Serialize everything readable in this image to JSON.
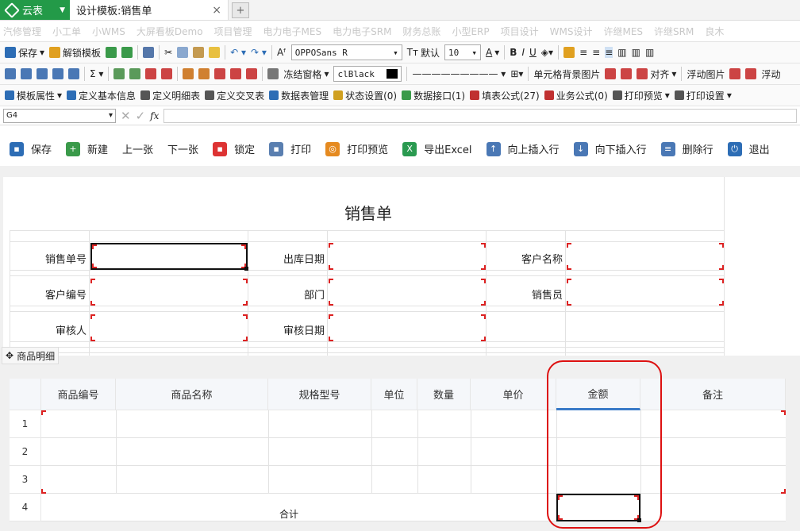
{
  "titlebar": {
    "app_name": "云表",
    "doc_tab": "设计模板:销售单",
    "close_symbol": "×",
    "newtab_symbol": "+"
  },
  "menubar": {
    "items": [
      "汽修管理",
      "小工单",
      "小WMS",
      "大屏看板Demo",
      "项目管理",
      "电力电子MES",
      "电力电子SRM",
      "财务总账",
      "小型ERP",
      "项目设计",
      "WMS设计",
      "许继MES",
      "许继SRM",
      "良木"
    ]
  },
  "toolbar1": {
    "save": "保存",
    "unlock": "解锁模板",
    "font": "OPPOSans R",
    "default_label": "默认",
    "size": "10"
  },
  "toolbar2": {
    "freeze": "冻结窗格",
    "color": "clBlack",
    "cell_bg_image": "单元格背景图片",
    "align": "对齐",
    "float_image": "浮动图片",
    "more": "浮动"
  },
  "toolbar3": {
    "items": [
      "模板属性",
      "定义基本信息",
      "定义明细表",
      "定义交叉表",
      "数据表管理",
      "状态设置(0)",
      "数据接口(1)",
      "填表公式(27)",
      "业务公式(0)",
      "打印预览",
      "打印设置"
    ]
  },
  "formula": {
    "cell_ref": "G4",
    "fx": "fx"
  },
  "actions": {
    "items": [
      "保存",
      "新建",
      "上一张",
      "下一张",
      "锁定",
      "打印",
      "打印预览",
      "导出Excel",
      "向上插入行",
      "向下插入行",
      "删除行",
      "退出"
    ]
  },
  "form": {
    "title": "销售单",
    "labels": [
      "销售单号",
      "出库日期",
      "客户名称",
      "客户编号",
      "部门",
      "销售员",
      "审核人",
      "审核日期"
    ]
  },
  "detail": {
    "section_label": "商品明细",
    "headers": [
      "商品编号",
      "商品名称",
      "规格型号",
      "单位",
      "数量",
      "单价",
      "金额",
      "备注"
    ],
    "rows": [
      "1",
      "2",
      "3",
      "4"
    ],
    "total_label": "合计"
  }
}
